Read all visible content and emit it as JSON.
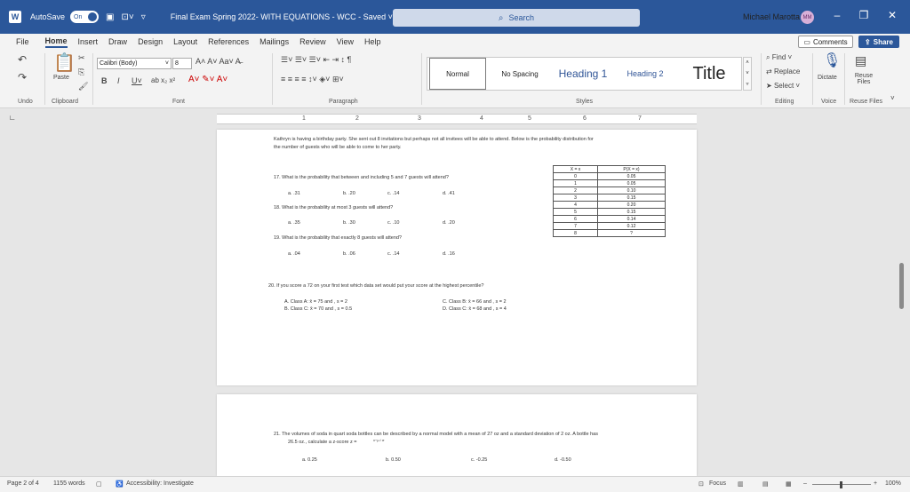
{
  "titlebar": {
    "app_icon": "word-icon",
    "autosave_label": "AutoSave",
    "autosave_state": "On",
    "doc_title": "Final Exam Spring 2022- WITH EQUATIONS - WCC - Saved ˅",
    "search_placeholder": "Search",
    "user_name": "Michael Marotta",
    "user_initials": "MM",
    "accent_color": "#2b579a"
  },
  "menu": {
    "tabs": [
      "File",
      "Home",
      "Insert",
      "Draw",
      "Design",
      "Layout",
      "References",
      "Mailings",
      "Review",
      "View",
      "Help"
    ],
    "active": "Home",
    "comments_label": "Comments",
    "share_label": "Share"
  },
  "ribbon": {
    "paste_label": "Paste",
    "font_name": "Calibri (Body)",
    "font_size": "8",
    "groups": [
      "Undo",
      "Clipboard",
      "Font",
      "Paragraph",
      "Styles",
      "Editing",
      "Voice",
      "Reuse Files"
    ],
    "styles": [
      "Normal",
      "No Spacing",
      "Heading 1",
      "Heading 2",
      "Title"
    ],
    "find_label": "Find",
    "replace_label": "Replace",
    "select_label": "Select",
    "dictate_label": "Dictate",
    "reuse_label": "Reuse Files"
  },
  "ruler": {
    "marks": [
      "1",
      "2",
      "3",
      "4",
      "5",
      "6",
      "7"
    ]
  },
  "document": {
    "intro_line1": "Kathryn is having a birthday party. She sent out 8 invitations but perhaps not all invitees will be able to attend. Below is the probability distribution for",
    "intro_line2": "the number of guests who will be able to come to her party.",
    "q17": "17.   What is the probability that between and including 5 and 7 guests will attend?",
    "q17_opts": [
      "a. .31",
      "b. .20",
      "c. .14",
      "d. .41"
    ],
    "q18": "18.   What is the probability at most 3 guests will attend?",
    "q18_opts": [
      "a. .35",
      "b. .30",
      "c. .10",
      "d. .20"
    ],
    "q19": "19.   What is the probability that exactly 8 guests will attend?",
    "q19_opts": [
      "a. .04",
      "b. .06",
      "c. .14",
      "d. .16"
    ],
    "table_headers": [
      "X = x",
      "P(X = x)"
    ],
    "table_rows": [
      [
        "0",
        "0.05"
      ],
      [
        "1",
        "0.05"
      ],
      [
        "2",
        "0.10"
      ],
      [
        "3",
        "0.15"
      ],
      [
        "4",
        "0.20"
      ],
      [
        "5",
        "0.15"
      ],
      [
        "6",
        "0.14"
      ],
      [
        "7",
        "0.12"
      ],
      [
        "8",
        "?"
      ]
    ],
    "q20": "20.   If you score a 72 on your first test which data set would put your score at the highest percentile?",
    "q20_opts": [
      "A.    Class A:  x̄ = 75  and , s = 2",
      "B.    Class C:  x̄ = 70  and , s = 0.5",
      "C. Class B:  x̄ = 66  and , s = 2",
      "D.  Class C:  x̄ = 68  and , s = 4"
    ],
    "q21_line1": "21.   The volumes of soda in quart soda bottles can be described by a normal model with a mean of 27 oz and a standard deviation of 2 oz.  A bottle has",
    "q21_line2": "26.5 oz., calculate a z-score   z =",
    "q21_fraction": "x−μ / σ",
    "q21_opts": [
      "a. 0.25",
      "b. 0.50",
      "c. -0.25",
      "d. -0.50"
    ]
  },
  "status": {
    "page": "Page 2 of 4",
    "words": "1155 words",
    "accessibility": "Accessibility: Investigate",
    "focus": "Focus",
    "zoom": "100%"
  }
}
